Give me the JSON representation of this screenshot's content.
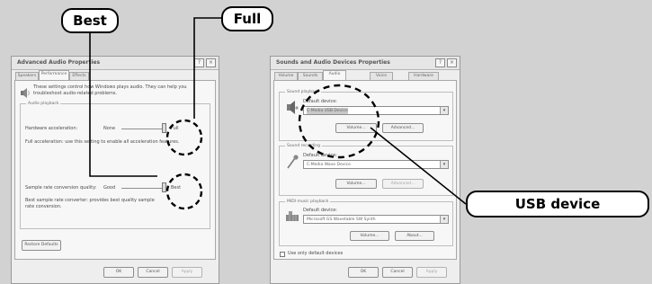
{
  "callouts": {
    "best": "Best",
    "full": "Full",
    "usb": "USB device"
  },
  "dialog1": {
    "title": "Advanced Audio Properties",
    "tabs": [
      "Speakers",
      "Performance",
      "Effects"
    ],
    "description": "These settings control how Windows plays audio. They can help you troubleshoot audio-related problems.",
    "group_label": "Audio playback",
    "hw_label": "Hardware acceleration:",
    "hw_min": "None",
    "hw_max": "Full",
    "hw_desc": "Full acceleration: use this setting to enable all acceleration features.",
    "sr_label": "Sample rate conversion quality:",
    "sr_min": "Good",
    "sr_max": "Best",
    "sr_desc": "Best sample rate converter: provides best quality sample rate conversion.",
    "restore_button": "Restore Defaults",
    "ok": "OK",
    "cancel": "Cancel",
    "apply": "Apply"
  },
  "dialog2": {
    "title": "Sounds and Audio Devices Properties",
    "tabs": [
      "Volume",
      "Sounds",
      "Audio",
      "Voice",
      "Hardware"
    ],
    "playback_label": "Sound playback",
    "default_device_label": "Default device:",
    "playback_device": "C-Media USB Device",
    "volume_button": "Volume...",
    "advanced_button": "Advanced...",
    "recording_label": "Sound recording",
    "recording_device": "C-Media Wave Device",
    "midi_label": "MIDI music playback",
    "midi_device": "Microsoft GS Wavetable SW Synth",
    "about_button": "About...",
    "only_default_label": "Use only default devices",
    "ok": "OK",
    "cancel": "Cancel",
    "apply": "Apply"
  }
}
